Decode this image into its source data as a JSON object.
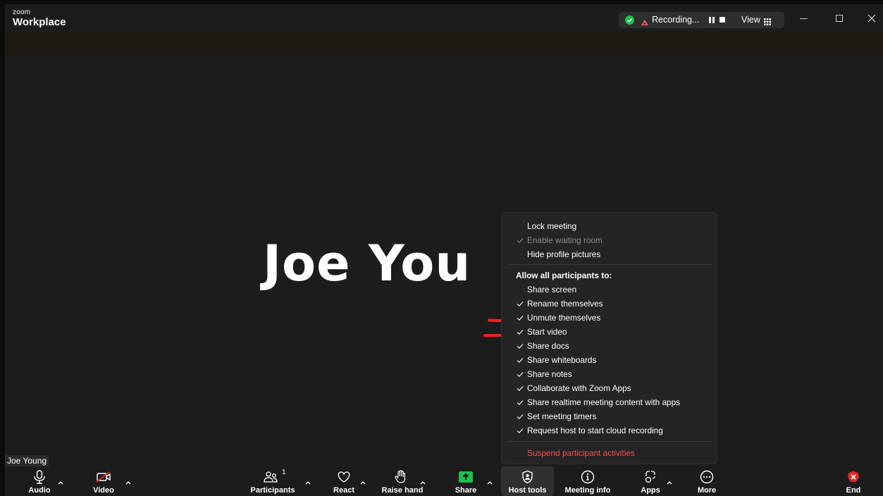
{
  "titlebar": {
    "brand_small": "zoom",
    "brand_big": "Workplace",
    "recording_label": "Recording...",
    "view_label": "View",
    "colors": {
      "secure": "#1fbf4d",
      "record": "#ff5a5a"
    }
  },
  "video": {
    "participant_display_name": "Joe You",
    "name_tag": "Joe Young"
  },
  "host_menu": {
    "items": [
      {
        "label": "Lock meeting",
        "checked": false,
        "disabled": false
      },
      {
        "label": "Enable waiting room",
        "checked": true,
        "disabled": true
      },
      {
        "label": "Hide profile pictures",
        "checked": false,
        "disabled": false
      }
    ],
    "section_header": "Allow all participants to:",
    "permissions": [
      {
        "label": "Share screen",
        "checked": false
      },
      {
        "label": "Rename themselves",
        "checked": true
      },
      {
        "label": "Unmute themselves",
        "checked": true
      },
      {
        "label": "Start video",
        "checked": true
      },
      {
        "label": "Share docs",
        "checked": true
      },
      {
        "label": "Share whiteboards",
        "checked": true
      },
      {
        "label": "Share notes",
        "checked": true
      },
      {
        "label": "Collaborate with Zoom Apps",
        "checked": true
      },
      {
        "label": "Share realtime meeting content with apps",
        "checked": true
      },
      {
        "label": "Set meeting timers",
        "checked": true
      },
      {
        "label": "Request host to start cloud recording",
        "checked": true
      }
    ],
    "suspend_label": "Suspend participant activities",
    "danger_color": "#ff4d4d"
  },
  "toolbar": {
    "audio": "Audio",
    "video": "Video",
    "participants": "Participants",
    "participants_count": "1",
    "react": "React",
    "raise_hand": "Raise hand",
    "share": "Share",
    "host_tools": "Host tools",
    "meeting_info": "Meeting info",
    "apps": "Apps",
    "more": "More",
    "end": "End",
    "colors": {
      "share": "#1fbf4d",
      "end": "#e02828",
      "video_off": "#e02828"
    }
  }
}
